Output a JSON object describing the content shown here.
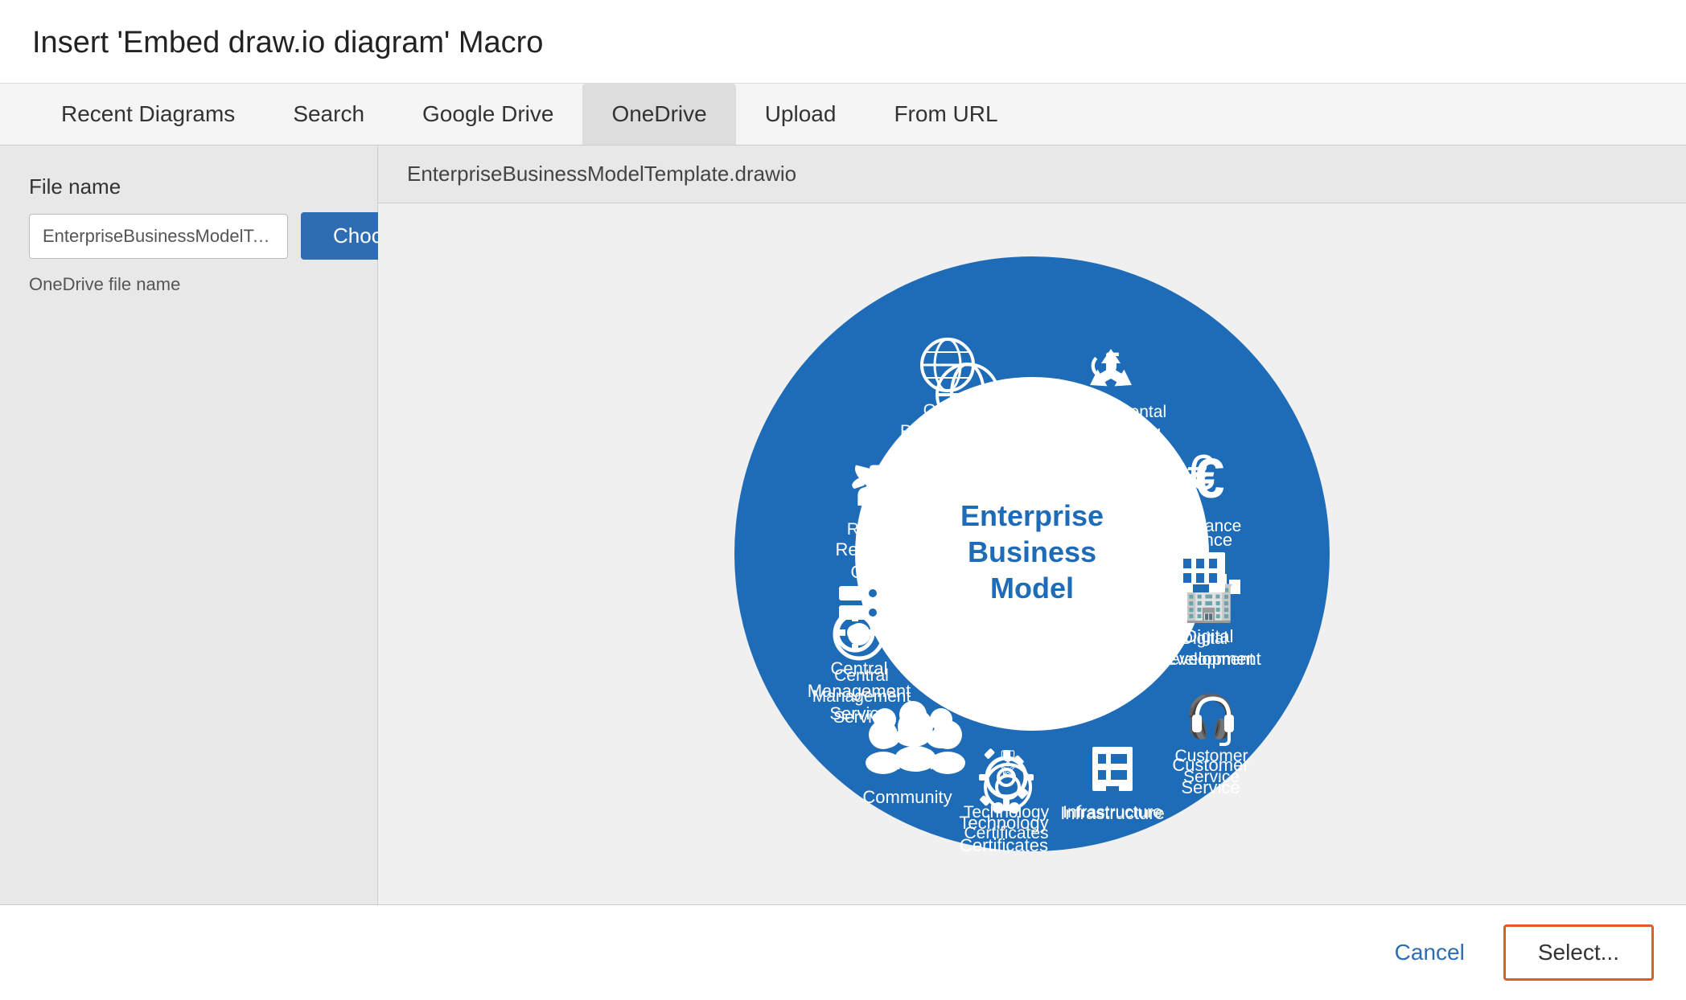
{
  "dialog": {
    "title": "Insert 'Embed draw.io diagram' Macro"
  },
  "tabs": [
    {
      "label": "Recent Diagrams",
      "active": false
    },
    {
      "label": "Search",
      "active": false
    },
    {
      "label": "Google Drive",
      "active": false
    },
    {
      "label": "OneDrive",
      "active": true
    },
    {
      "label": "Upload",
      "active": false
    },
    {
      "label": "From URL",
      "active": false
    }
  ],
  "left": {
    "file_name_label": "File name",
    "file_input_value": "EnterpriseBusinessModelTemplate.dra",
    "choose_button": "Choose",
    "onedrive_label": "OneDrive file name"
  },
  "right": {
    "preview_filename": "EnterpriseBusinessModelTemplate.drawio"
  },
  "diagram": {
    "center_title": "Enterprise Business Model",
    "segments": [
      {
        "label": "Global Partnerships",
        "icon": "globe"
      },
      {
        "label": "Environmental Awareness",
        "icon": "recycle"
      },
      {
        "label": "Finance",
        "icon": "euro"
      },
      {
        "label": "Digital Development",
        "icon": "building"
      },
      {
        "label": "Customer Service",
        "icon": "headset"
      },
      {
        "label": "Infrastructure",
        "icon": "building2"
      },
      {
        "label": "Technology Certificates",
        "icon": "certificate"
      },
      {
        "label": "Community",
        "icon": "people"
      },
      {
        "label": "Central Management Service",
        "icon": "server"
      },
      {
        "label": "Response Group",
        "icon": "phone"
      }
    ]
  },
  "footer": {
    "cancel_label": "Cancel",
    "select_label": "Select..."
  }
}
